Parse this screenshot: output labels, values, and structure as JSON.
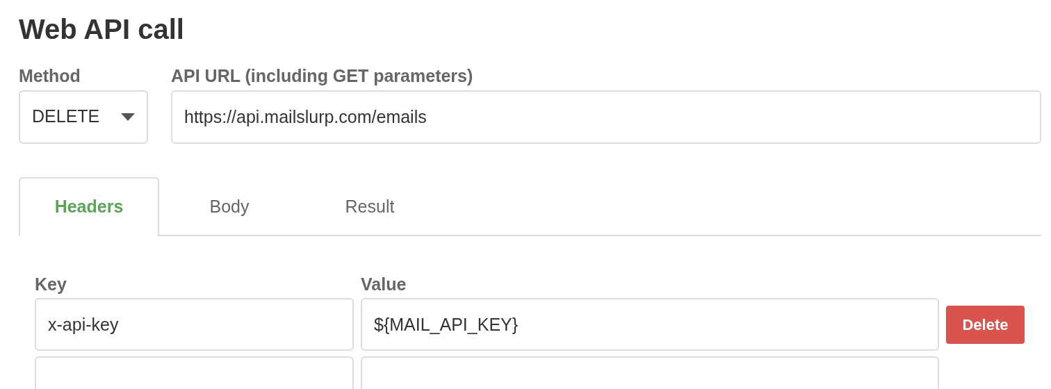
{
  "title": "Web API call",
  "method": {
    "label": "Method",
    "value": "DELETE"
  },
  "url": {
    "label": "API URL (including GET parameters)",
    "value": "https://api.mailslurp.com/emails"
  },
  "tabs": [
    {
      "label": "Headers",
      "selected": true
    },
    {
      "label": "Body",
      "selected": false
    },
    {
      "label": "Result",
      "selected": false
    }
  ],
  "headers": {
    "key_label": "Key",
    "value_label": "Value",
    "rows": [
      {
        "key": "x-api-key",
        "value": "${MAIL_API_KEY}",
        "delete": "Delete"
      },
      {}
    ]
  }
}
